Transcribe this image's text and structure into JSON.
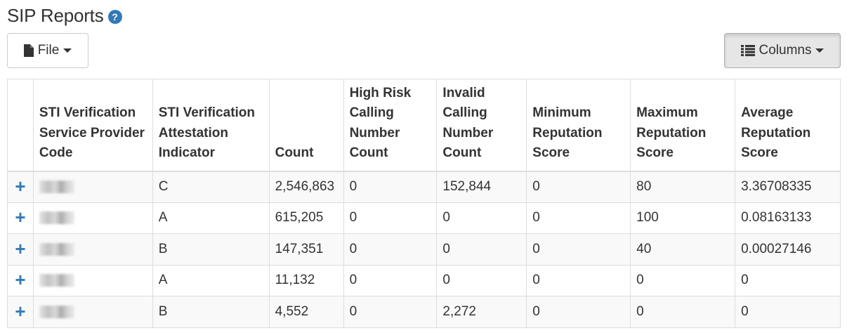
{
  "page": {
    "title": "SIP Reports",
    "help_icon": "question-circle-icon"
  },
  "toolbar": {
    "file_label": "File",
    "file_icon": "file-icon",
    "columns_label": "Columns",
    "columns_icon": "list-icon",
    "accent_color": "#337ab7"
  },
  "table": {
    "columns": [
      "",
      "STI Verification Service Provider Code",
      "STI Verification Attestation Indicator",
      "Count",
      "High Risk Calling Number Count",
      "Invalid Calling Number Count",
      "Minimum Reputation Score",
      "Maximum Reputation Score",
      "Average Reputation Score"
    ],
    "rows": [
      {
        "expand": "+",
        "attestation": "C",
        "count": "2,546,863",
        "high_risk": "0",
        "invalid": "152,844",
        "min": "0",
        "max": "80",
        "avg": "3.36708335"
      },
      {
        "expand": "+",
        "attestation": "A",
        "count": "615,205",
        "high_risk": "0",
        "invalid": "0",
        "min": "0",
        "max": "100",
        "avg": "0.08163133"
      },
      {
        "expand": "+",
        "attestation": "B",
        "count": "147,351",
        "high_risk": "0",
        "invalid": "0",
        "min": "0",
        "max": "40",
        "avg": "0.00027146"
      },
      {
        "expand": "+",
        "attestation": "A",
        "count": "11,132",
        "high_risk": "0",
        "invalid": "0",
        "min": "0",
        "max": "0",
        "avg": "0"
      },
      {
        "expand": "+",
        "attestation": "B",
        "count": "4,552",
        "high_risk": "0",
        "invalid": "2,272",
        "min": "0",
        "max": "0",
        "avg": "0"
      }
    ]
  }
}
